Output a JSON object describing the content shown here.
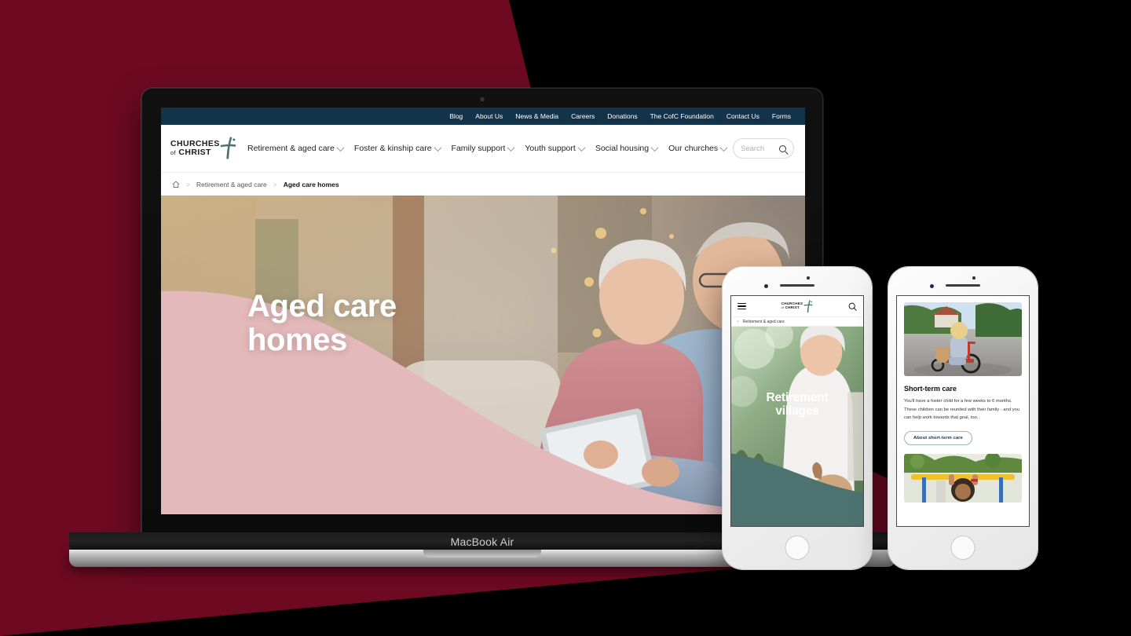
{
  "background": {
    "page_color": "#000000",
    "accent_shape_color": "#6d0a22"
  },
  "devices": {
    "laptop": {
      "label": "MacBook Air"
    },
    "phone1": {
      "name": "iPhone"
    },
    "phone2": {
      "name": "iPhone"
    }
  },
  "brand": {
    "line1": "CHURCHES",
    "line2_small": "of",
    "line2": "CHRIST",
    "navy": "#123349",
    "teal": "#4d7371",
    "pink": "#e4b9bb"
  },
  "site": {
    "topbar": {
      "links": [
        {
          "label": "Blog"
        },
        {
          "label": "About Us"
        },
        {
          "label": "News & Media"
        },
        {
          "label": "Careers"
        },
        {
          "label": "Donations"
        },
        {
          "label": "The CofC Foundation"
        },
        {
          "label": "Contact Us"
        },
        {
          "label": "Forms"
        }
      ]
    },
    "mainnav": {
      "items": [
        {
          "label": "Retirement & aged care"
        },
        {
          "label": "Foster & kinship care"
        },
        {
          "label": "Family support"
        },
        {
          "label": "Youth support"
        },
        {
          "label": "Social housing"
        },
        {
          "label": "Our churches"
        }
      ],
      "search": {
        "placeholder": "Search",
        "value": ""
      }
    },
    "breadcrumb": {
      "home_icon": "home-icon",
      "items": [
        {
          "label": "Retirement & aged care",
          "current": false
        },
        {
          "label": "Aged care homes",
          "current": true
        }
      ]
    },
    "hero": {
      "title_line1": "Aged care",
      "title_line2": "homes",
      "image_alt": "Senior couple on couch using a tablet"
    }
  },
  "phone1": {
    "menu_icon": "hamburger-icon",
    "search_icon": "search-icon",
    "breadcrumb": {
      "label": "Retirement & aged care"
    },
    "hero": {
      "title_line1": "Retirement",
      "title_line2": "villages",
      "image_alt": "Smiling senior woman outdoors with a dog"
    }
  },
  "phone2": {
    "card": {
      "heading": "Short-term care",
      "body": "You'll have a foster child for a few weeks to 6 months. These children can be reunited with their family - and you can help work towards that goal, too.",
      "button_label": "About short-term care",
      "image_alt": "Young child riding a red tricycle with a teddy bear"
    },
    "card2": {
      "image_alt": "Smiling child on yellow playground equipment"
    }
  }
}
